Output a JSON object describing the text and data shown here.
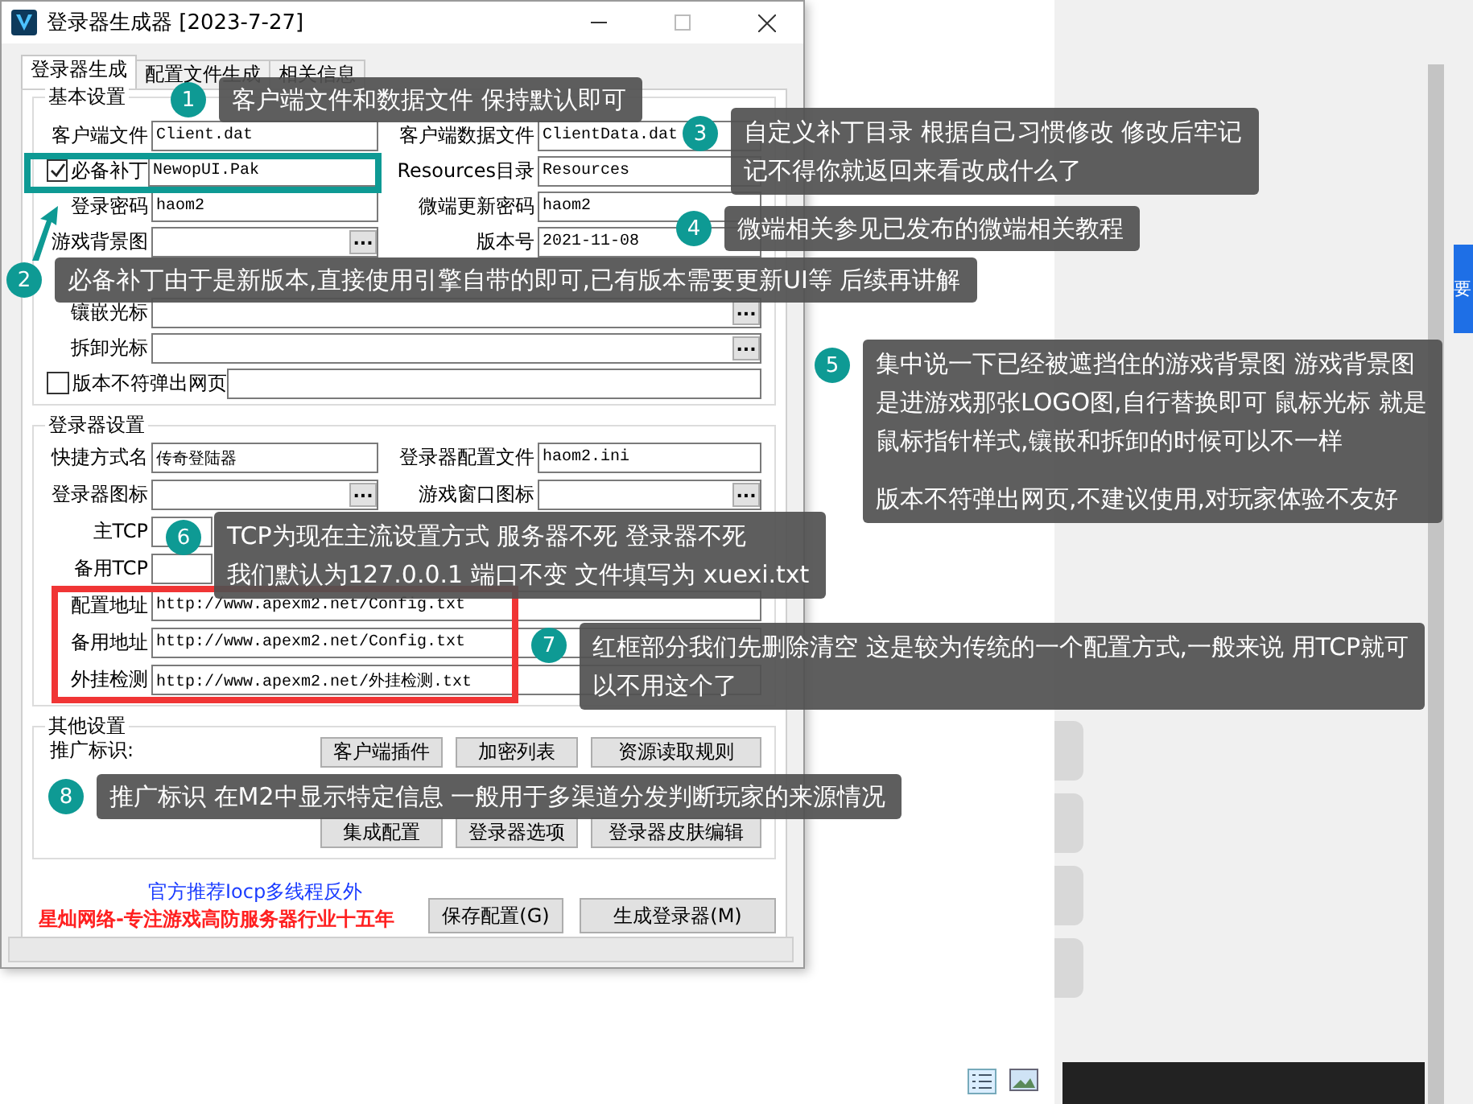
{
  "window": {
    "title": "登录器生成器 [2023-7-27]"
  },
  "tabs": [
    {
      "label": "登录器生成",
      "selected": true
    },
    {
      "label": "配置文件生成",
      "selected": false
    },
    {
      "label": "相关信息",
      "selected": false
    }
  ],
  "basic_settings": {
    "title": "基本设置",
    "rows": [
      {
        "cells": [
          {
            "kind": "text",
            "label": "客户端文件",
            "value": "Client.dat"
          },
          {
            "kind": "text",
            "label": "客户端数据文件",
            "value": "ClientData.dat"
          }
        ]
      },
      {
        "cells": [
          {
            "kind": "check_text",
            "label": "必备补丁",
            "checked": true,
            "value": "NewopUI.Pak"
          },
          {
            "kind": "text",
            "label": "Resources目录",
            "value": "Resources"
          }
        ]
      },
      {
        "cells": [
          {
            "kind": "text",
            "label": "登录密码",
            "value": "haom2"
          },
          {
            "kind": "text",
            "label": "微端更新密码",
            "value": "haom2"
          }
        ]
      },
      {
        "cells": [
          {
            "kind": "browse",
            "label": "游戏背景图",
            "button": "..."
          },
          {
            "kind": "text",
            "label": "版本号",
            "value": "2021-11-08"
          }
        ]
      },
      {
        "cells": [
          {
            "kind": "covered"
          }
        ]
      },
      {
        "cells": [
          {
            "kind": "browse",
            "label": "镶嵌光标",
            "button": "..."
          }
        ]
      },
      {
        "cells": [
          {
            "kind": "browse",
            "label": "拆卸光标",
            "button": "..."
          }
        ]
      },
      {
        "cells": [
          {
            "kind": "check_text",
            "label": "版本不符弹出网页",
            "checked": false
          }
        ]
      }
    ]
  },
  "login_settings": {
    "title": "登录器设置",
    "rows": [
      {
        "cells": [
          {
            "kind": "text",
            "label": "快捷方式名",
            "value": "传奇登陆器"
          },
          {
            "kind": "text",
            "label": "登录器配置文件",
            "value": "haom2.ini"
          }
        ]
      },
      {
        "cells": [
          {
            "kind": "browse",
            "label": "登录器图标",
            "button": "..."
          },
          {
            "kind": "browse",
            "label": "游戏窗口图标",
            "button": "..."
          }
        ]
      },
      {
        "cells": [
          {
            "kind": "text",
            "label": "主TCP"
          }
        ]
      },
      {
        "cells": [
          {
            "kind": "text",
            "label": "备用TCP"
          }
        ]
      },
      {
        "cells": [
          {
            "kind": "text",
            "label": "配置地址",
            "value": "http://www.apexm2.net/Config.txt"
          }
        ]
      },
      {
        "cells": [
          {
            "kind": "text",
            "label": "备用地址",
            "value": "http://www.apexm2.net/Config.txt"
          }
        ]
      },
      {
        "cells": [
          {
            "kind": "text",
            "label": "外挂检测",
            "value": "http://www.apexm2.net/外挂检测.txt"
          }
        ]
      }
    ]
  },
  "other_settings": {
    "title": "其他设置",
    "promo_label": "推广标识:",
    "buttons_top": [
      "客户端插件",
      "加密列表",
      "资源读取规则"
    ],
    "buttons_bottom": [
      "集成配置",
      "登录器选项",
      "登录器皮肤编辑"
    ]
  },
  "footer": {
    "link": "官方推荐Iocp多线程反外",
    "slogan": "星灿网络-专注游戏高防服务器行业十五年",
    "buttons": [
      "保存配置(G)",
      "生成登录器(M)"
    ]
  },
  "side_tab": "要",
  "callouts": [
    {
      "number": "1",
      "paragraphs": [
        [
          "客户端文件和数据文件 保持默认即可"
        ]
      ]
    },
    {
      "number": "2",
      "paragraphs": [
        [
          "必备补丁由于是新版本,直接使用引擎自带的即可,已有版本需要更新UI等 后续再讲解"
        ]
      ]
    },
    {
      "number": "3",
      "paragraphs": [
        [
          "自定义补丁目录 根据自己习惯修改 修改后牢记",
          "记不得你就返回来看改成什么了"
        ]
      ]
    },
    {
      "number": "4",
      "paragraphs": [
        [
          "微端相关参见已发布的微端相关教程"
        ]
      ]
    },
    {
      "number": "5",
      "paragraphs": [
        [
          "集中说一下已经被遮挡住的游戏背景图 游戏背景图",
          "是进游戏那张LOGO图,自行替换即可 鼠标光标 就是",
          "鼠标指针样式,镶嵌和拆卸的时候可以不一样"
        ],
        [
          "版本不符弹出网页,不建议使用,对玩家体验不友好"
        ]
      ]
    },
    {
      "number": "6",
      "paragraphs": [
        [
          "TCP为现在主流设置方式 服务器不死 登录器不死",
          "我们默认为127.0.0.1 端口不变 文件填写为 xuexi.txt"
        ]
      ]
    },
    {
      "number": "7",
      "paragraphs": [
        [
          "红框部分我们先删除清空 这是较为传统的一个配置方式,一般来说 用TCP就可",
          "以不用这个了"
        ]
      ]
    },
    {
      "number": "8",
      "paragraphs": [
        [
          "推广标识 在M2中显示特定信息 一般用于多渠道分发判断玩家的来源情况"
        ]
      ]
    }
  ]
}
